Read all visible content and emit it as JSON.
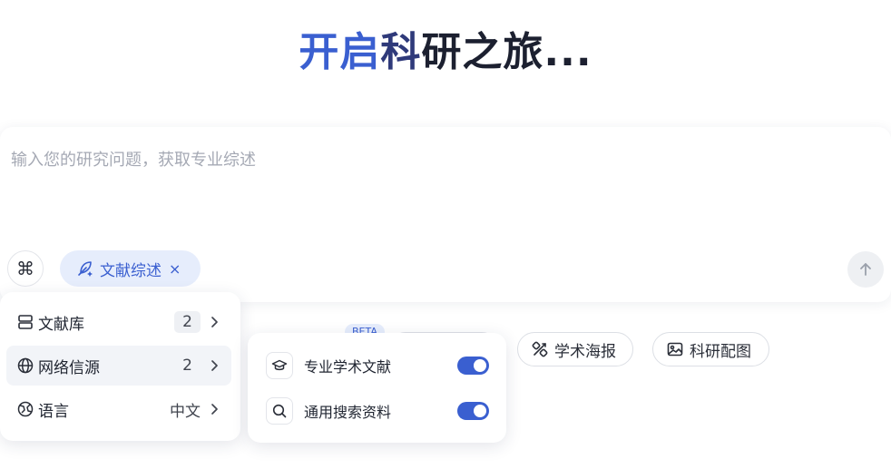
{
  "title": {
    "part1": "开启",
    "part2": "科",
    "part3": "研之旅..."
  },
  "composer": {
    "placeholder": "输入您的研究问题，获取专业综述",
    "command_symbol": "⌘",
    "chip_label": "文献综述",
    "chip_close": "×"
  },
  "tools": {
    "beta_badge": "BETA",
    "poster_label": "学术海报",
    "figure_label": "科研配图"
  },
  "source_menu": {
    "items": [
      {
        "label": "文献库",
        "value": "2",
        "icon": "library-icon"
      },
      {
        "label": "网络信源",
        "value": "2",
        "icon": "globe-icon"
      },
      {
        "label": "语言",
        "value": "中文",
        "icon": "language-icon"
      }
    ]
  },
  "web_sources": {
    "items": [
      {
        "label": "专业学术文献",
        "enabled": true,
        "icon": "graduation-cap-icon"
      },
      {
        "label": "通用搜索资料",
        "enabled": true,
        "icon": "search-icon"
      }
    ]
  },
  "colors": {
    "accent": "#3a5fd0",
    "chip_bg": "#e6edfc"
  }
}
